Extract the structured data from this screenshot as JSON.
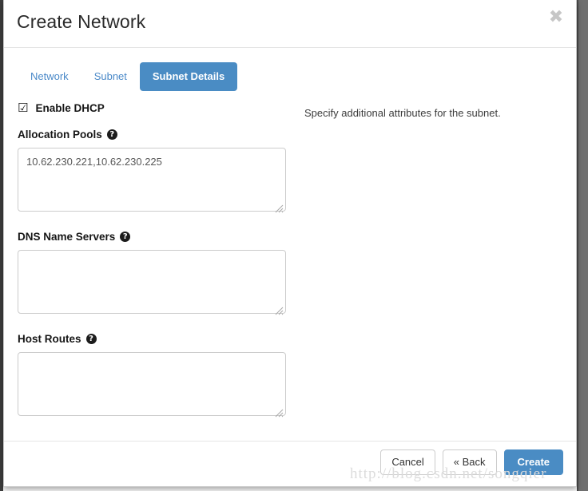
{
  "dialog": {
    "title": "Create Network",
    "close_icon": "close-icon",
    "close_glyph": "✖"
  },
  "tabs": [
    {
      "label": "Network",
      "active": false
    },
    {
      "label": "Subnet",
      "active": false
    },
    {
      "label": "Subnet Details",
      "active": true
    }
  ],
  "form": {
    "enable_dhcp": {
      "label": "Enable DHCP",
      "checked": true,
      "glyph": "☑"
    },
    "help_glyph": "?",
    "fields": [
      {
        "label": "Allocation Pools",
        "value": "10.62.230.221,10.62.230.225",
        "placeholder": "",
        "help": "?"
      },
      {
        "label": "DNS Name Servers",
        "value": "",
        "placeholder": "",
        "help": "?"
      },
      {
        "label": "Host Routes",
        "value": "",
        "placeholder": "",
        "help": "?"
      }
    ]
  },
  "help_panel": {
    "description": "Specify additional attributes for the subnet."
  },
  "footer": {
    "cancel_label": "Cancel",
    "back_label": "« Back",
    "create_label": "Create"
  },
  "watermark": {
    "text": "http://blog.csdn.net/songqier"
  },
  "colors": {
    "accent": "#4a8cc4",
    "tab_link": "#4a89c8",
    "border": "#cccccc",
    "text": "#161616"
  }
}
